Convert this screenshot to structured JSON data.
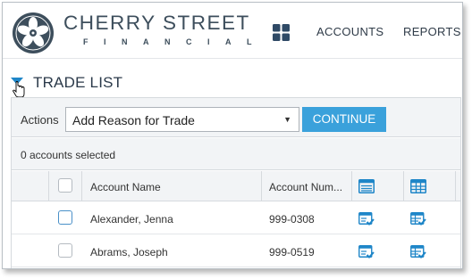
{
  "header": {
    "brand_line1": "CHERRY STREET",
    "brand_line2": "FINANCIAL",
    "apps_icon": "grid-icon",
    "nav": [
      {
        "label": "ACCOUNTS"
      },
      {
        "label": "REPORTS"
      }
    ]
  },
  "section": {
    "title": "TRADE LIST",
    "toggle_icon": "caret-down-icon"
  },
  "actions": {
    "label": "Actions",
    "selected_value": "Add Reason for Trade",
    "button_label": "CONTINUE"
  },
  "selection_status": "0 accounts selected",
  "table": {
    "columns": [
      {
        "label": ""
      },
      {
        "label": "Account Name"
      },
      {
        "label": "Account Num..."
      },
      {
        "label": "",
        "icon": "list-view-icon"
      },
      {
        "label": "",
        "icon": "table-view-icon"
      }
    ],
    "rows": [
      {
        "name": "Alexander, Jenna",
        "number": "999-0308"
      },
      {
        "name": "Abrams, Joseph",
        "number": "999-0519"
      }
    ]
  },
  "colors": {
    "accent": "#3aa1db",
    "brand_dark": "#3d4e5c",
    "header_bg": "#f2f4f6",
    "icon_blue": "#1f86c8"
  }
}
